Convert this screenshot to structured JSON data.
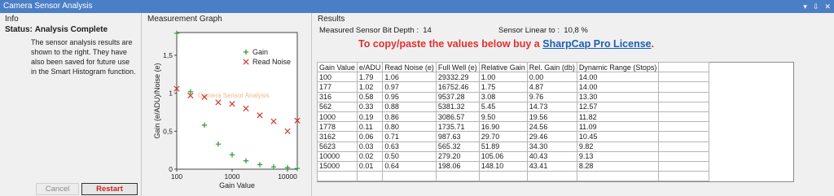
{
  "window": {
    "title": "Camera Sensor Analysis",
    "controls": [
      "▾",
      "⇩",
      "✕"
    ]
  },
  "info": {
    "heading": "Info",
    "status_label": "Status:",
    "status_value": "Analysis Complete",
    "description": "The sensor analysis results are shown to the right. They have also been saved for future use in the Smart Histogram function."
  },
  "buttons": {
    "cancel": "Cancel",
    "restart": "Restart"
  },
  "graph": {
    "heading": "Measurement Graph",
    "watermark": "Camera Sensor Analysis",
    "chart_data": {
      "type": "scatter",
      "xscale": "log",
      "xlabel": "Gain Value",
      "ylabel": "Gain (e/ADU)/Noise (e)",
      "xlim": [
        100,
        15000
      ],
      "ylim": [
        0,
        1.8
      ],
      "xticks": [
        100,
        1000,
        10000
      ],
      "xtick_labels": [
        "100",
        "1000",
        "10000"
      ],
      "yticks": [
        0,
        0.5,
        1,
        1.5
      ],
      "ytick_labels": [
        "0",
        "0,5",
        "1",
        "1,5"
      ],
      "legend": "top-right",
      "series": [
        {
          "name": "Gain",
          "marker": "plus",
          "color": "#2e9a2e",
          "x": [
            100,
            177,
            316,
            562,
            1000,
            1778,
            3162,
            5623,
            10000,
            15000
          ],
          "y": [
            1.79,
            1.02,
            0.58,
            0.33,
            0.19,
            0.11,
            0.06,
            0.03,
            0.02,
            0.01
          ]
        },
        {
          "name": "Read Noise",
          "marker": "x",
          "color": "#d03a2a",
          "x": [
            100,
            177,
            316,
            562,
            1000,
            1778,
            3162,
            5623,
            10000,
            15000
          ],
          "y": [
            1.06,
            0.97,
            0.95,
            0.88,
            0.86,
            0.8,
            0.71,
            0.63,
            0.5,
            0.64
          ]
        }
      ]
    }
  },
  "results": {
    "heading": "Results",
    "bit_depth_label": "Measured Sensor Bit Depth :",
    "bit_depth_value": "14",
    "linear_label": "Sensor Linear to :",
    "linear_value": "10,8 %",
    "promo_text": "To copy/paste the values below buy a",
    "promo_link": "SharpCap Pro License",
    "promo_end": ".",
    "columns": [
      "Gain Value",
      "e/ADU",
      "Read Noise (e)",
      "Full Well (e)",
      "Relative Gain",
      "Rel. Gain (db)",
      "Dynamic Range (Stops)",
      ""
    ],
    "rows": [
      [
        "100",
        "1.79",
        "1.06",
        "29332.29",
        "1.00",
        "0.00",
        "14.00",
        ""
      ],
      [
        "177",
        "1.02",
        "0.97",
        "16752.46",
        "1.75",
        "4.87",
        "14.00",
        ""
      ],
      [
        "316",
        "0.58",
        "0.95",
        "9537.28",
        "3.08",
        "9.76",
        "13.30",
        ""
      ],
      [
        "562",
        "0.33",
        "0.88",
        "5381.32",
        "5.45",
        "14.73",
        "12.57",
        ""
      ],
      [
        "1000",
        "0.19",
        "0.86",
        "3086.57",
        "9.50",
        "19.56",
        "11.82",
        ""
      ],
      [
        "1778",
        "0.11",
        "0.80",
        "1735.71",
        "16.90",
        "24.56",
        "11.09",
        ""
      ],
      [
        "3162",
        "0.06",
        "0.71",
        "987.63",
        "29.70",
        "29.46",
        "10.45",
        ""
      ],
      [
        "5623",
        "0.03",
        "0.63",
        "565.32",
        "51.89",
        "34.30",
        "9.82",
        ""
      ],
      [
        "10000",
        "0.02",
        "0.50",
        "279.20",
        "105.06",
        "40.43",
        "9.13",
        ""
      ],
      [
        "15000",
        "0.01",
        "0.64",
        "198.06",
        "148.10",
        "43.41",
        "8.28",
        ""
      ],
      [
        "",
        "",
        "",
        "",
        "",
        "",
        "",
        ""
      ]
    ]
  }
}
